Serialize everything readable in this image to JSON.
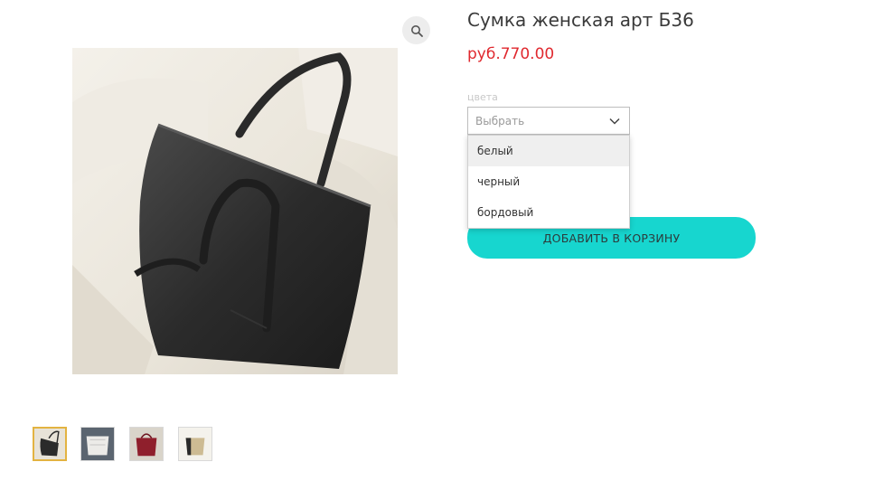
{
  "product": {
    "title": "Сумка женская арт Б36",
    "price": "руб.770.00"
  },
  "zoom": {
    "icon": "magnifier-icon"
  },
  "options": {
    "label": "цвета",
    "placeholder": "Выбрать",
    "items": [
      "белый",
      "черный",
      "бордовый"
    ],
    "highlighted_index": 0
  },
  "cart": {
    "button_label": "ДОБАВИТЬ В КОРЗИНУ"
  },
  "colors": {
    "price": "#e0292f",
    "button": "#17d6cf",
    "active_thumb_border": "#e3b341"
  },
  "thumbnails": [
    {
      "name": "black-bag",
      "active": true
    },
    {
      "name": "white-bag",
      "active": false
    },
    {
      "name": "burgundy-bag",
      "active": false
    },
    {
      "name": "beige-bag",
      "active": false
    }
  ]
}
